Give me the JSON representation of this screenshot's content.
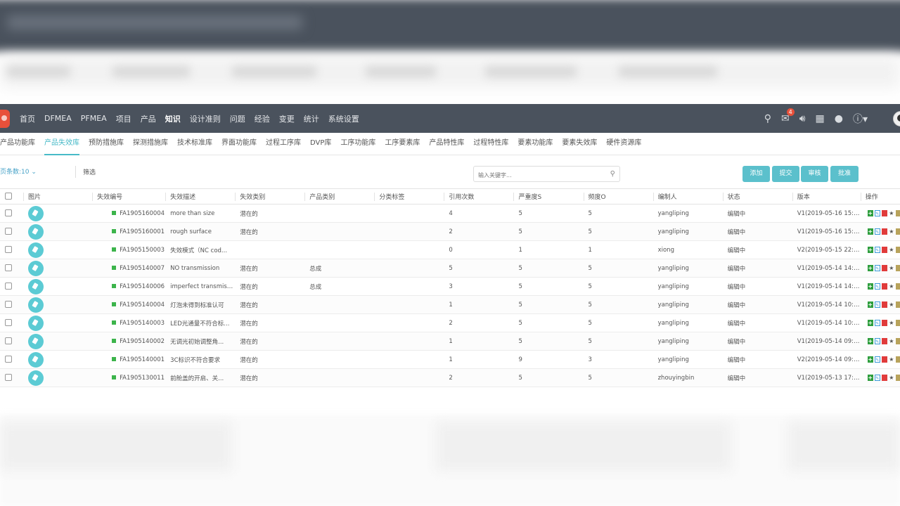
{
  "nav": {
    "items": [
      "首页",
      "DFMEA",
      "PFMEA",
      "项目",
      "产品",
      "知识",
      "设计准则",
      "问题",
      "经验",
      "变更",
      "统计",
      "系统设置"
    ],
    "active_index": 5,
    "mail_badge": "4",
    "icons": [
      "search-icon",
      "mail-icon",
      "speaker-icon",
      "calendar-icon",
      "chat-icon",
      "help-icon"
    ]
  },
  "subnav": {
    "items": [
      "产品功能库",
      "产品失效库",
      "预防措施库",
      "探测措施库",
      "技术标准库",
      "界面功能库",
      "过程工序库",
      "DVP库",
      "工序功能库",
      "工序要素库",
      "产品特性库",
      "过程特性库",
      "要素功能库",
      "要素失效库",
      "硬件资源库"
    ],
    "active_index": 1
  },
  "toolbar": {
    "page_size": "页条数:10",
    "filter_label": "筛选",
    "search_placeholder": "输入关键字...",
    "buttons": [
      "添加",
      "提交",
      "审核",
      "批准"
    ]
  },
  "table": {
    "headers": [
      "图片",
      "失效编号",
      "失效描述",
      "失效类别",
      "产品类别",
      "分类标签",
      "引用次数",
      "严重度S",
      "频度O",
      "编制人",
      "状态",
      "版本",
      "操作"
    ],
    "rows": [
      {
        "code": "FA1905160004",
        "desc": "more than size",
        "category": "潜在的",
        "product_cat": "",
        "tag": "",
        "refs": "4",
        "severity": "5",
        "freq": "5",
        "author": "yangliping",
        "status": "编辑中",
        "version": "V1(2019-05-16 15:1..."
      },
      {
        "code": "FA1905160001",
        "desc": "rough surface",
        "category": "潜在的",
        "product_cat": "",
        "tag": "",
        "refs": "2",
        "severity": "5",
        "freq": "5",
        "author": "yangliping",
        "status": "编辑中",
        "version": "V1(2019-05-16 15:0..."
      },
      {
        "code": "FA1905150003",
        "desc": "失效模式（NC cod...",
        "category": "",
        "product_cat": "",
        "tag": "",
        "refs": "0",
        "severity": "1",
        "freq": "1",
        "author": "xiong",
        "status": "编辑中",
        "version": "V2(2019-05-15 22:4..."
      },
      {
        "code": "FA1905140007",
        "desc": "NO transmission",
        "category": "潜在的",
        "product_cat": "总成",
        "tag": "",
        "refs": "5",
        "severity": "5",
        "freq": "5",
        "author": "yangliping",
        "status": "编辑中",
        "version": "V1(2019-05-14 14:3..."
      },
      {
        "code": "FA1905140006",
        "desc": "imperfect transmiss...",
        "category": "潜在的",
        "product_cat": "总成",
        "tag": "",
        "refs": "3",
        "severity": "5",
        "freq": "5",
        "author": "yangliping",
        "status": "编辑中",
        "version": "V1(2019-05-14 14:3..."
      },
      {
        "code": "FA1905140004",
        "desc": "灯泡未得到标准认可",
        "category": "潜在的",
        "product_cat": "",
        "tag": "",
        "refs": "1",
        "severity": "5",
        "freq": "5",
        "author": "yangliping",
        "status": "编辑中",
        "version": "V1(2019-05-14 10:1..."
      },
      {
        "code": "FA1905140003",
        "desc": "LED光通量不符合标...",
        "category": "潜在的",
        "product_cat": "",
        "tag": "",
        "refs": "2",
        "severity": "5",
        "freq": "5",
        "author": "yangliping",
        "status": "编辑中",
        "version": "V1(2019-05-14 10:0..."
      },
      {
        "code": "FA1905140002",
        "desc": "无调光初始调整角...",
        "category": "潜在的",
        "product_cat": "",
        "tag": "",
        "refs": "1",
        "severity": "5",
        "freq": "5",
        "author": "yangliping",
        "status": "编辑中",
        "version": "V1(2019-05-14 09:5..."
      },
      {
        "code": "FA1905140001",
        "desc": "3C标识不符合要求",
        "category": "潜在的",
        "product_cat": "",
        "tag": "",
        "refs": "1",
        "severity": "9",
        "freq": "3",
        "author": "yangliping",
        "status": "编辑中",
        "version": "V2(2019-05-14 09:5..."
      },
      {
        "code": "FA1905130011",
        "desc": "前舱盖的开启、关...",
        "category": "潜在的",
        "product_cat": "",
        "tag": "",
        "refs": "2",
        "severity": "5",
        "freq": "5",
        "author": "zhouyingbin",
        "status": "编辑中",
        "version": "V1(2019-05-13 17:1..."
      }
    ]
  },
  "colors": {
    "nav_bg": "#4a525d",
    "accent": "#5bc0cc",
    "active_tab": "#48bac8",
    "code_marker": "#3cb44b"
  }
}
